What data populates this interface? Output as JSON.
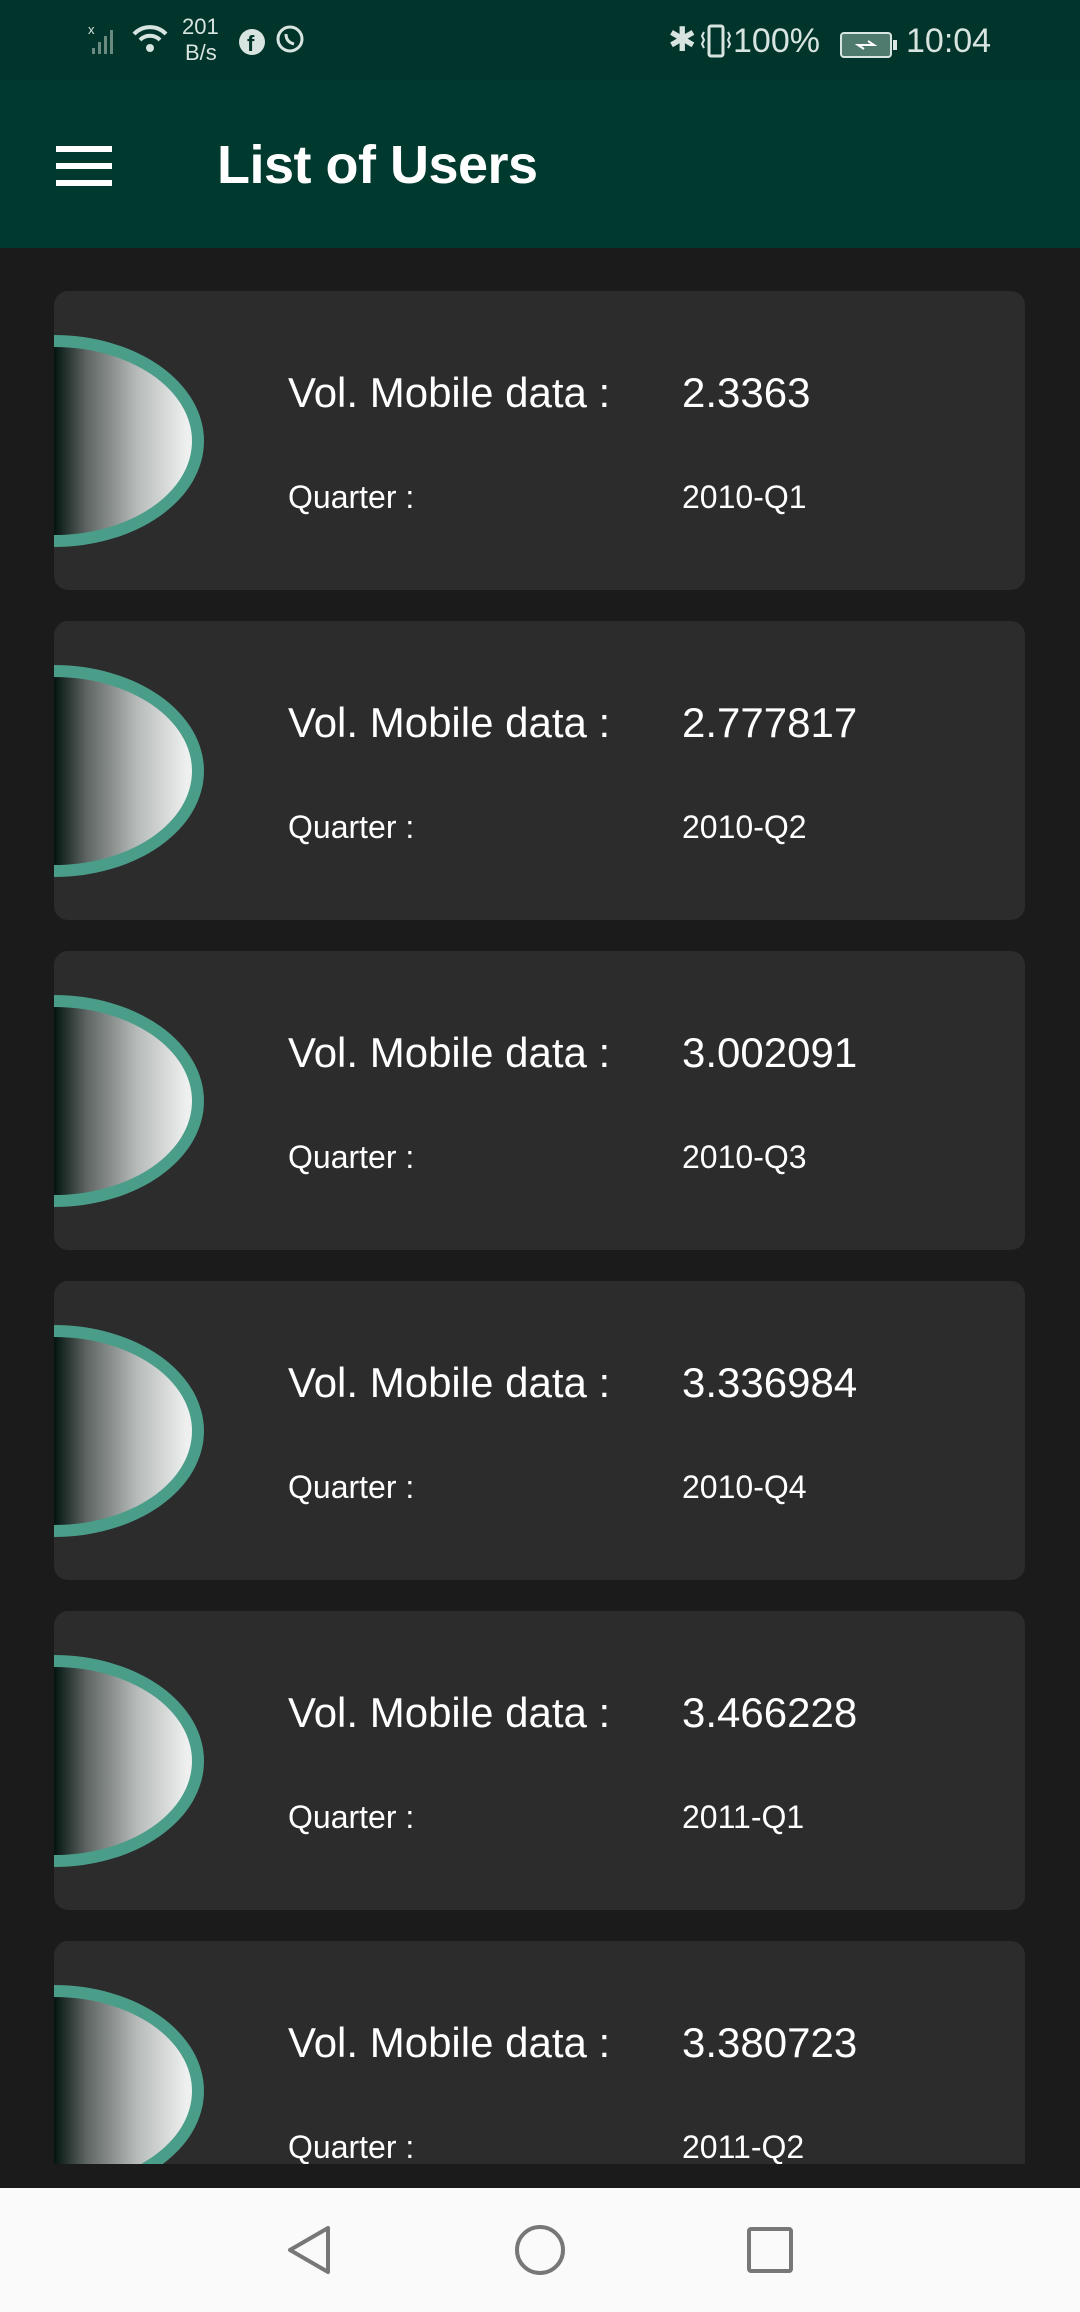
{
  "status_bar": {
    "net_speed_value": "201",
    "net_speed_unit": "B/s",
    "battery": "100%",
    "time": "10:04"
  },
  "header": {
    "title": "List of Users"
  },
  "labels": {
    "volume": "Vol. Mobile data :",
    "quarter": "Quarter :"
  },
  "items": [
    {
      "volume": "2.3363",
      "quarter": "2010-Q1"
    },
    {
      "volume": "2.777817",
      "quarter": "2010-Q2"
    },
    {
      "volume": "3.002091",
      "quarter": "2010-Q3"
    },
    {
      "volume": "3.336984",
      "quarter": "2010-Q4"
    },
    {
      "volume": "3.466228",
      "quarter": "2011-Q1"
    },
    {
      "volume": "3.380723",
      "quarter": "2011-Q2"
    }
  ]
}
